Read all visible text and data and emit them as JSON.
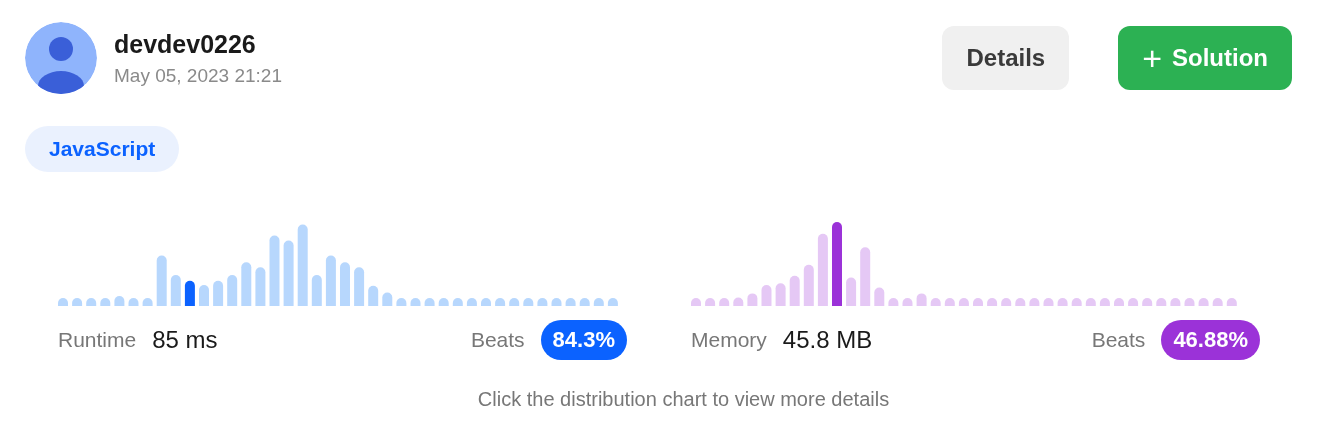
{
  "author": {
    "name": "devdev0226",
    "date": "May 05, 2023 21:21"
  },
  "buttons": [
    {
      "label": "Details",
      "kind": "plain"
    },
    {
      "label": "Solution",
      "kind": "primary",
      "icon": "+"
    }
  ],
  "language_tag": "JavaScript",
  "stats": [
    {
      "label": "Runtime",
      "value": "85 ms",
      "beats_label": "Beats",
      "beats": "84.3%",
      "kind": "runtime"
    },
    {
      "label": "Memory",
      "value": "45.8 MB",
      "beats_label": "Beats",
      "beats": "46.88%",
      "kind": "memory"
    }
  ],
  "hint": "Click the distribution chart to view more details"
}
